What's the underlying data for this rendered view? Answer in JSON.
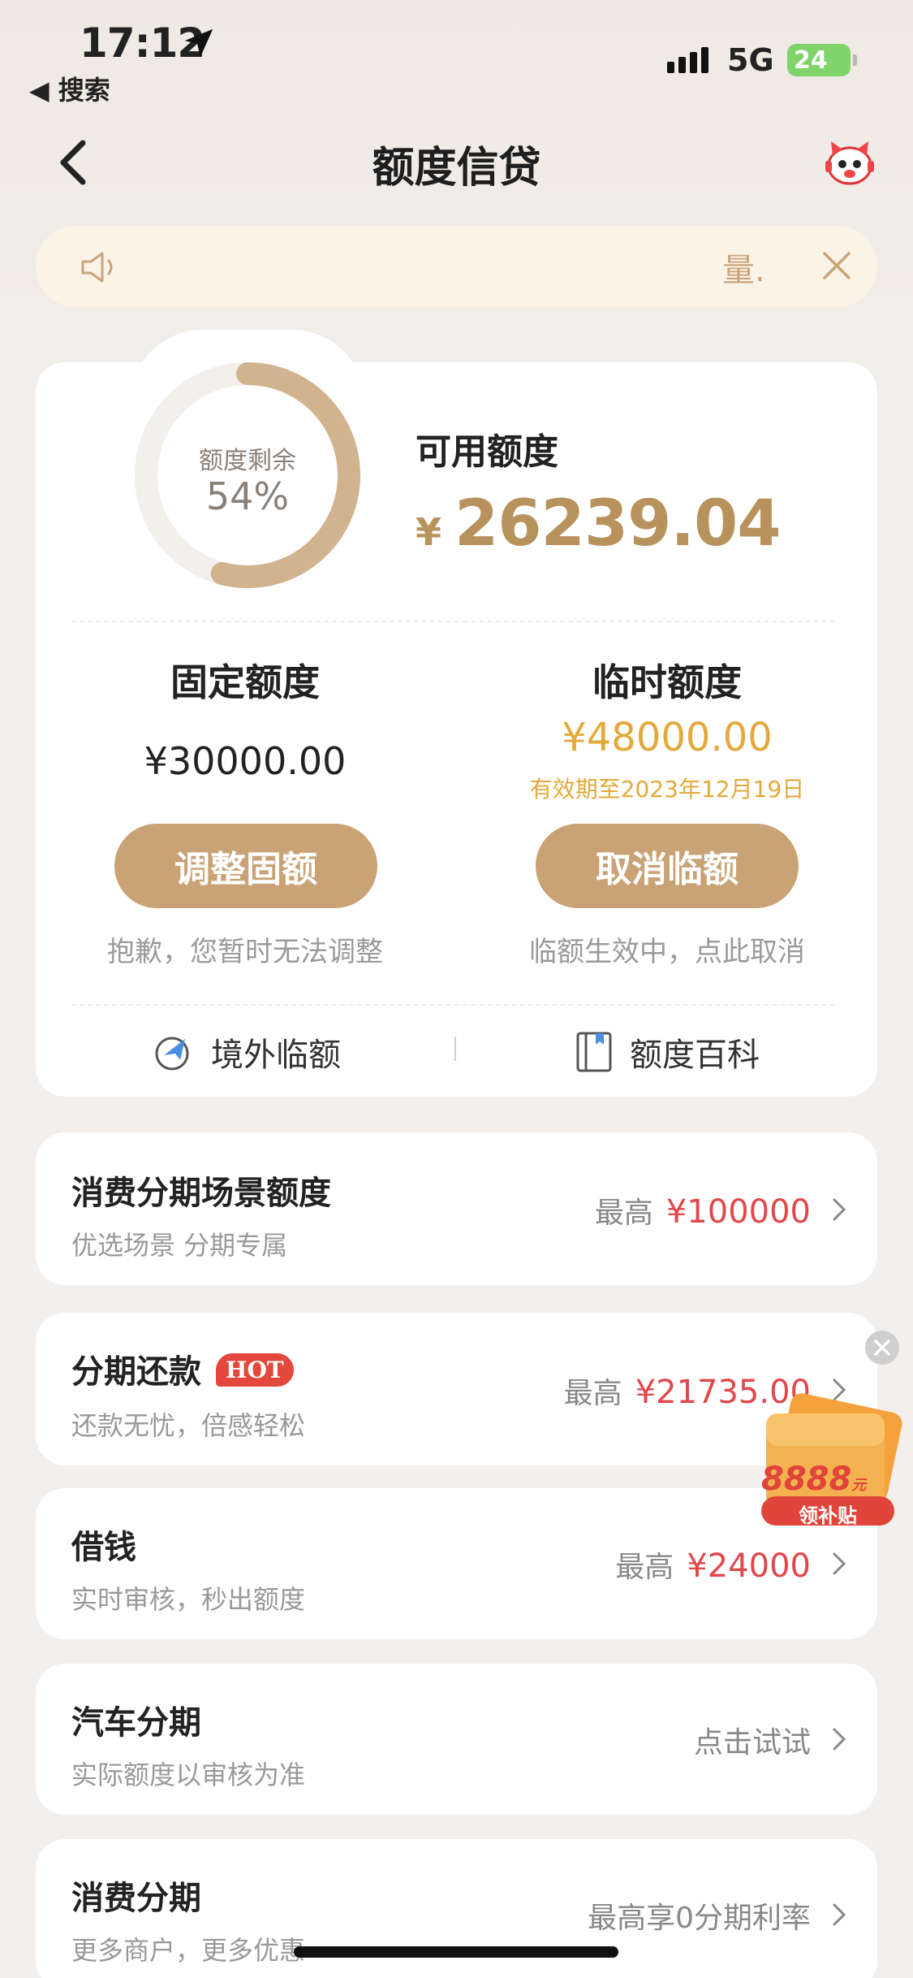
{
  "status_bar": {
    "time": "17:12",
    "back_app": "◀ 搜索",
    "network": "5G",
    "battery": "24"
  },
  "nav": {
    "title": "额度信贷"
  },
  "notice": {
    "text": "量."
  },
  "credit": {
    "ring_label": "额度剩余",
    "ring_value": "54%",
    "ring_fraction": 0.54,
    "available_label": "可用额度",
    "currency": "¥",
    "available_amount": "26239.04"
  },
  "fixed": {
    "title": "固定额度",
    "amount": "¥30000.00",
    "button": "调整固额",
    "note": "抱歉，您暂时无法调整"
  },
  "temp": {
    "title": "临时额度",
    "amount": "¥48000.00",
    "valid": "有效期至2023年12月19日",
    "button": "取消临额",
    "note": "临额生效中，点此取消"
  },
  "links": {
    "overseas": "境外临额",
    "wiki": "额度百科"
  },
  "list": [
    {
      "title": "消费分期场景额度",
      "sub": "优选场景 分期专属",
      "prefix": "最高",
      "value": "¥100000"
    },
    {
      "title": "分期还款",
      "badge": "HOT",
      "sub": "还款无忧，倍感轻松",
      "prefix": "最高",
      "value": "¥21735.00"
    },
    {
      "title": "借钱",
      "sub": "实时审核，秒出额度",
      "prefix": "最高",
      "value": "¥24000"
    },
    {
      "title": "汽车分期",
      "sub": "实际额度以审核为准",
      "prefix": "点击试试",
      "value": ""
    },
    {
      "title": "消费分期",
      "sub": "更多商户，更多优惠",
      "prefix": "最高享0分期利率",
      "value": ""
    }
  ],
  "float_badge": {
    "amount": "8888",
    "unit": "元",
    "label": "领补贴"
  },
  "colors": {
    "gold": "#b8925c",
    "button": "#c9a376",
    "orange": "#e4a93b",
    "red": "#e2474b",
    "bg": "#f2efec"
  }
}
